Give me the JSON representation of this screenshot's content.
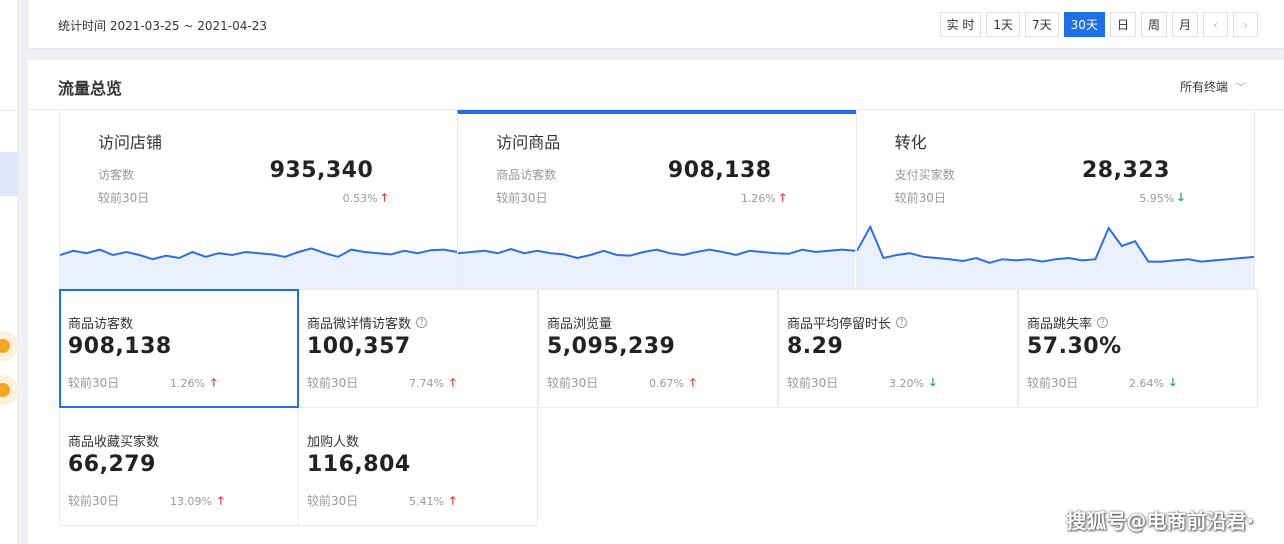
{
  "date_bar": {
    "label": "统计时间 2021-03-25 ~ 2021-04-23",
    "ranges": [
      "实 时",
      "1天",
      "7天",
      "30天",
      "日",
      "周",
      "月"
    ],
    "active_range": "30天",
    "prev_icon": "‹",
    "next_icon": "›"
  },
  "panel": {
    "title": "流量总览",
    "terminal_select": "所有终端",
    "terminal_chevron": "﹀"
  },
  "cards": [
    {
      "title": "访问店铺",
      "metric": "访客数",
      "value": "935,340",
      "compare": "较前30日",
      "pct": "0.53%",
      "trend": "up",
      "spark": [
        0.55,
        0.48,
        0.52,
        0.46,
        0.55,
        0.5,
        0.55,
        0.62,
        0.56,
        0.6,
        0.5,
        0.58,
        0.52,
        0.55,
        0.5,
        0.52,
        0.54,
        0.58,
        0.5,
        0.44,
        0.52,
        0.58,
        0.46,
        0.5,
        0.52,
        0.54,
        0.48,
        0.52,
        0.47,
        0.46,
        0.5
      ]
    },
    {
      "title": "访问商品",
      "metric": "商品访客数",
      "value": "908,138",
      "compare": "较前30日",
      "pct": "1.26%",
      "trend": "up",
      "spark": [
        0.52,
        0.5,
        0.48,
        0.52,
        0.45,
        0.52,
        0.48,
        0.52,
        0.54,
        0.6,
        0.55,
        0.48,
        0.55,
        0.56,
        0.5,
        0.46,
        0.52,
        0.55,
        0.5,
        0.46,
        0.5,
        0.55,
        0.48,
        0.5,
        0.52,
        0.53,
        0.46,
        0.5,
        0.48,
        0.46,
        0.48
      ]
    },
    {
      "title": "转化",
      "metric": "支付买家数",
      "value": "28,323",
      "compare": "较前30日",
      "pct": "5.95%",
      "trend": "down",
      "spark": [
        0.48,
        0.08,
        0.6,
        0.55,
        0.52,
        0.58,
        0.6,
        0.62,
        0.65,
        0.6,
        0.68,
        0.62,
        0.64,
        0.62,
        0.66,
        0.62,
        0.6,
        0.64,
        0.62,
        0.1,
        0.4,
        0.32,
        0.66,
        0.66,
        0.64,
        0.62,
        0.66,
        0.64,
        0.62,
        0.6,
        0.58
      ]
    }
  ],
  "metrics": [
    {
      "label": "商品访客数",
      "help": false,
      "value": "908,138",
      "compare": "较前30日",
      "pct": "1.26%",
      "trend": "up",
      "selected": true
    },
    {
      "label": "商品微详情访客数",
      "help": true,
      "value": "100,357",
      "compare": "较前30日",
      "pct": "7.74%",
      "trend": "up",
      "selected": false
    },
    {
      "label": "商品浏览量",
      "help": false,
      "value": "5,095,239",
      "compare": "较前30日",
      "pct": "0.67%",
      "trend": "up",
      "selected": false
    },
    {
      "label": "商品平均停留时长",
      "help": true,
      "value": "8.29",
      "compare": "较前30日",
      "pct": "3.20%",
      "trend": "down",
      "selected": false
    },
    {
      "label": "商品跳失率",
      "help": true,
      "value": "57.30%",
      "compare": "较前30日",
      "pct": "2.64%",
      "trend": "down",
      "selected": false
    },
    {
      "label": "商品收藏买家数",
      "help": false,
      "value": "66,279",
      "compare": "较前30日",
      "pct": "13.09%",
      "trend": "up",
      "selected": false
    },
    {
      "label": "加购人数",
      "help": false,
      "value": "116,804",
      "compare": "较前30日",
      "pct": "5.41%",
      "trend": "up",
      "selected": false
    }
  ],
  "icons": {
    "up": "🡑",
    "down": "🡓",
    "help": "?"
  },
  "watermark": "搜狐号@电商前沿君·",
  "colors": {
    "accent": "#1f6fe5",
    "up": "#e53935",
    "down": "#18a058",
    "spark_line": "#2f6ee0",
    "spark_fill": "#eaf1fd"
  }
}
